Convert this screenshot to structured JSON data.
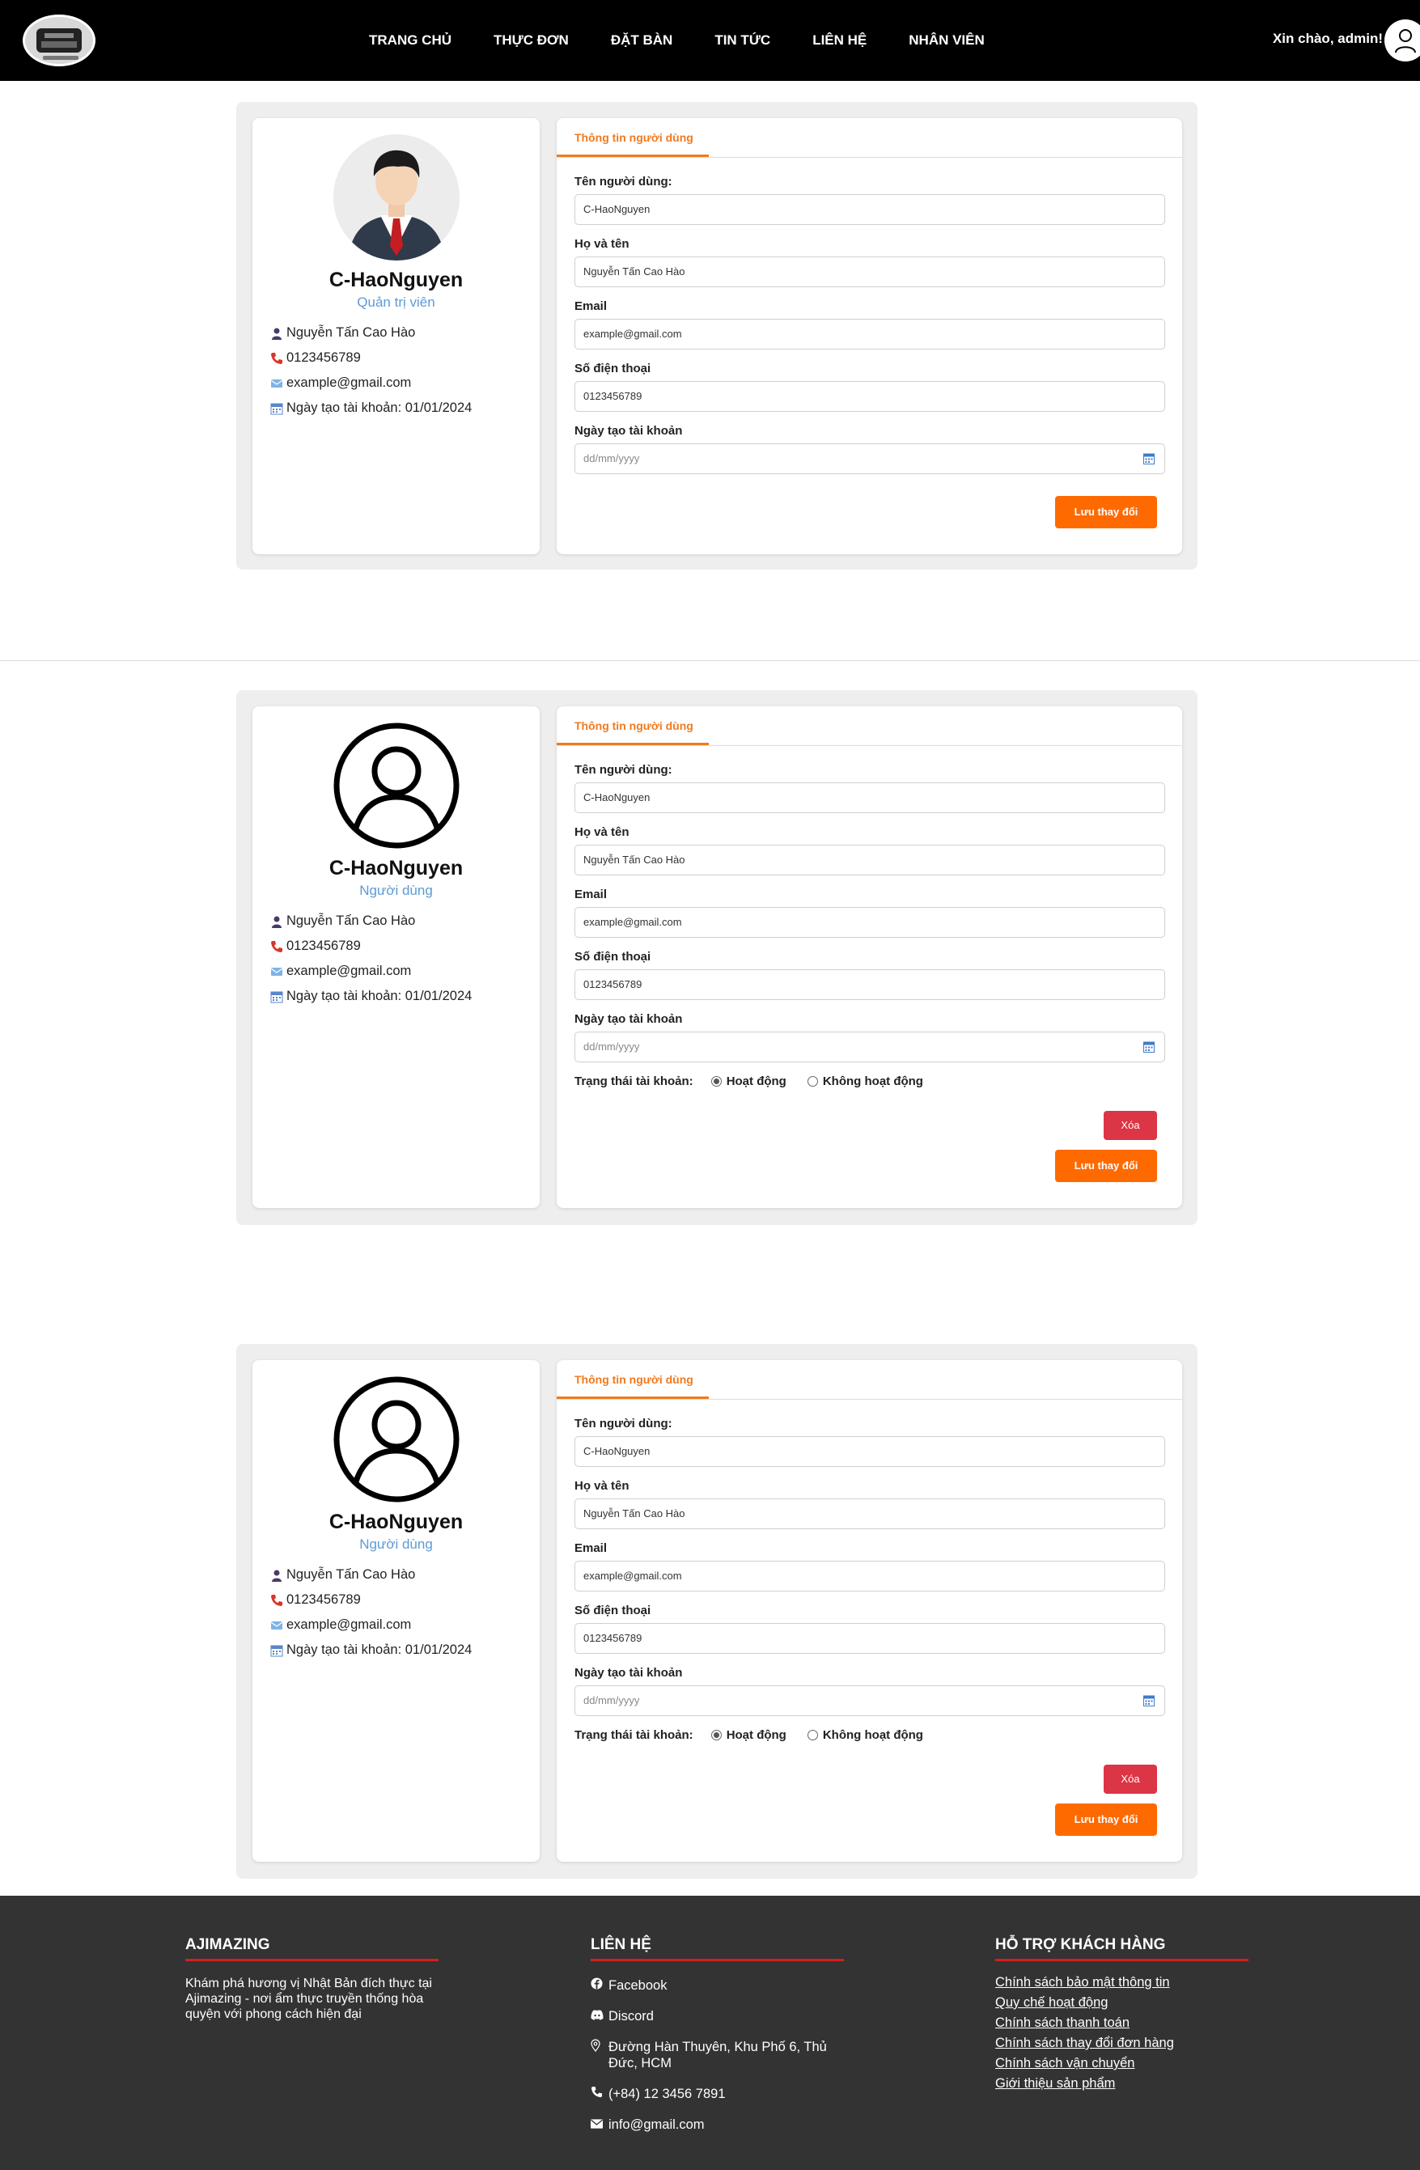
{
  "header": {
    "nav": [
      "TRANG CHỦ",
      "THỰC ĐƠN",
      "ĐẶT BÀN",
      "TIN TỨC",
      "LIÊN HỆ",
      "NHÂN VIÊN"
    ],
    "greeting": "Xin chào, admin!"
  },
  "profiles": [
    {
      "username": "C-HaoNguyen",
      "role": "Quản trị viên",
      "fullname": "Nguyễn Tấn Cao Hào",
      "phone": "0123456789",
      "email": "example@gmail.com",
      "created": "Ngày tạo tài khoản: 01/01/2024",
      "tab": "Thông tin người dùng",
      "labels": {
        "username": "Tên người dùng:",
        "fullname": "Họ và tên",
        "email": "Email",
        "phone": "Số điện thoại",
        "created": "Ngày tạo tài khoản"
      },
      "date_placeholder": "dd/mm/yyyy",
      "save": "Lưu thay đổi"
    },
    {
      "username": "C-HaoNguyen",
      "role": "Người dùng",
      "fullname": "Nguyễn Tấn Cao Hào",
      "phone": "0123456789",
      "email": "example@gmail.com",
      "created": "Ngày tạo tài khoản: 01/01/2024",
      "tab": "Thông tin người dùng",
      "labels": {
        "username": "Tên người dùng:",
        "fullname": "Họ và tên",
        "email": "Email",
        "phone": "Số điện thoại",
        "created": "Ngày tạo tài khoản"
      },
      "date_placeholder": "dd/mm/yyyy",
      "status_label": "Trạng thái tài khoản:",
      "status_active": "Hoạt động",
      "status_inactive": "Không hoạt động",
      "delete": "Xóa",
      "save": "Lưu thay đổi"
    },
    {
      "username": "C-HaoNguyen",
      "role": "Người dùng",
      "fullname": "Nguyễn Tấn Cao Hào",
      "phone": "0123456789",
      "email": "example@gmail.com",
      "created": "Ngày tạo tài khoản: 01/01/2024",
      "tab": "Thông tin người dùng",
      "labels": {
        "username": "Tên người dùng:",
        "fullname": "Họ và tên",
        "email": "Email",
        "phone": "Số điện thoại",
        "created": "Ngày tạo tài khoản"
      },
      "date_placeholder": "dd/mm/yyyy",
      "status_label": "Trạng thái tài khoản:",
      "status_active": "Hoạt động",
      "status_inactive": "Không hoạt động",
      "delete": "Xóa",
      "save": "Lưu thay đổi"
    }
  ],
  "footer": {
    "brand_title": "AJIMAZING",
    "brand_desc": "Khám phá hương vị Nhật Bản đích thực tại Ajimazing - nơi ẩm thực truyền thống hòa quyện với phong cách hiện đại",
    "contact_title": "LIÊN HỆ",
    "contact": [
      "Facebook",
      "Discord",
      "Đường Hàn Thuyên, Khu Phố 6, Thủ Đức, HCM",
      "(+84) 12 3456 7891",
      "info@gmail.com"
    ],
    "support_title": "HỖ TRỢ KHÁCH HÀNG",
    "support": [
      "Chính sách bảo mật thông tin",
      "Quy chế hoạt động",
      "Chính sách thanh toán",
      "Chính sách thay đổi đơn hàng",
      "Chính sách vận chuyển",
      "Giới thiệu sản phẩm"
    ]
  }
}
